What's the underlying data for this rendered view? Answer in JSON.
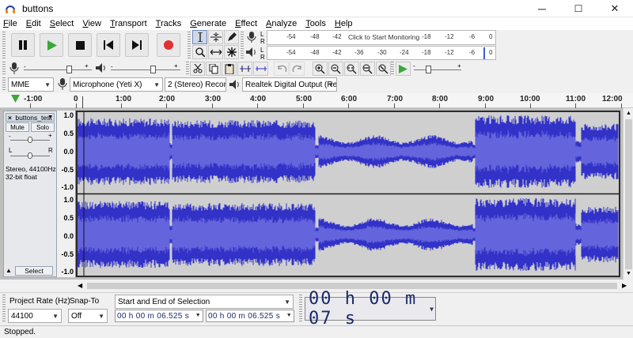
{
  "window": {
    "title": "buttons",
    "minimize": "─",
    "maximize": "☐",
    "close": "✕"
  },
  "menu": [
    "File",
    "Edit",
    "Select",
    "View",
    "Transport",
    "Tracks",
    "Generate",
    "Effect",
    "Analyze",
    "Tools",
    "Help"
  ],
  "meters": {
    "record_ticks": [
      "-54",
      "-48",
      "-42",
      "-18",
      "-12",
      "-6",
      "0"
    ],
    "record_prompt": "Click to Start Monitoring",
    "play_ticks": [
      "-54",
      "-48",
      "-42",
      "-36",
      "-30",
      "-24",
      "-18",
      "-12",
      "-6",
      "0"
    ],
    "lr": {
      "left": "L",
      "right": "R"
    }
  },
  "devices": {
    "host": "MME",
    "input": "Microphone (Yeti X)",
    "channels": "2 (Stereo) Recor",
    "output": "Realtek Digital Output (Real"
  },
  "ruler": {
    "labels": [
      "-1:00",
      "0",
      "1:00",
      "2:00",
      "3:00",
      "4:00",
      "5:00",
      "6:00",
      "7:00",
      "8:00",
      "9:00",
      "10:00",
      "11:00",
      "12:00"
    ]
  },
  "track": {
    "name": "buttons_test",
    "mute": "Mute",
    "solo": "Solo",
    "pan_left": "L",
    "pan_right": "R",
    "info_rate": "Stereo, 44100Hz",
    "info_format": "32-bit float",
    "select": "Select",
    "close": "×",
    "collapse": "▲"
  },
  "vruler": [
    "1.0",
    "0.5",
    "0.0",
    "-0.5",
    "-1.0"
  ],
  "selection_toolbar": {
    "project_rate_label": "Project Rate (Hz)",
    "project_rate_value": "44100",
    "snap_label": "Snap-To",
    "snap_value": "Off",
    "selection_mode": "Start and End of Selection",
    "start_time": "00 h 00 m 06.525 s",
    "end_time": "00 h 00 m 06.525 s",
    "audio_position": "00 h 00 m 07 s"
  },
  "status": "Stopped.",
  "colors": {
    "wave": "#3232c8",
    "wave_rms": "#6464dc",
    "record": "#e03030",
    "play": "#3aa83a",
    "track_bg": "#cfcfcf"
  }
}
